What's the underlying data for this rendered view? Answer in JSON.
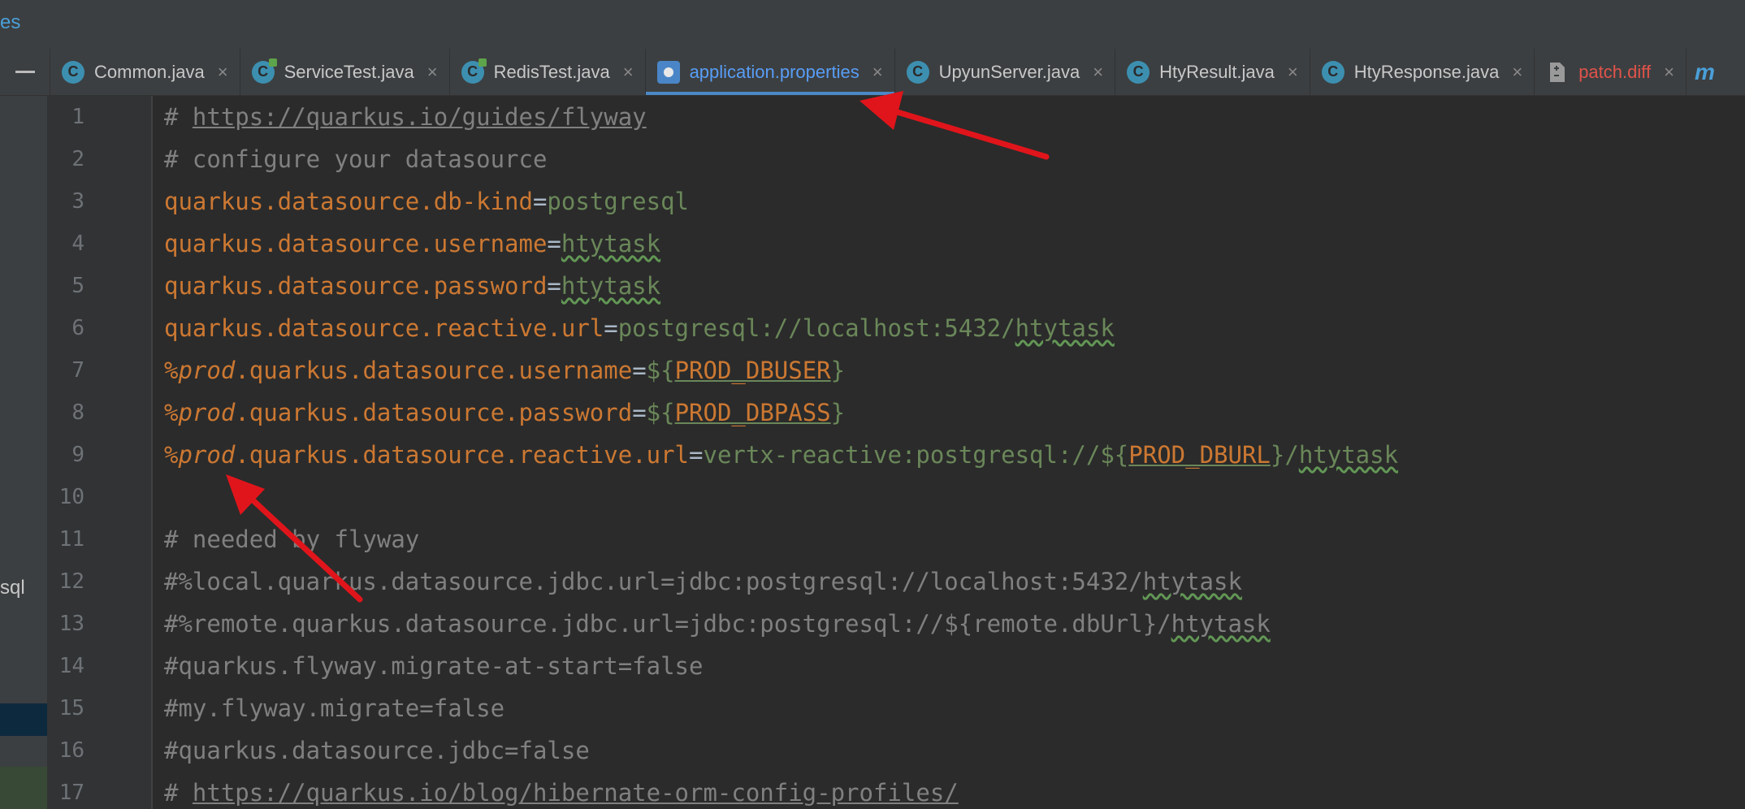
{
  "topstrip": {
    "crumb": "es"
  },
  "tabs": [
    {
      "label": "Common.java",
      "icon": "class-icon",
      "icon_glyph": "C",
      "kind": "class",
      "active": false
    },
    {
      "label": "ServiceTest.java",
      "icon": "test-class-icon",
      "icon_glyph": "C",
      "kind": "test",
      "active": false
    },
    {
      "label": "RedisTest.java",
      "icon": "test-class-icon",
      "icon_glyph": "C",
      "kind": "test",
      "active": false
    },
    {
      "label": "application.properties",
      "icon": "properties-icon",
      "icon_glyph": "",
      "kind": "props",
      "active": true
    },
    {
      "label": "UpyunServer.java",
      "icon": "class-icon",
      "icon_glyph": "C",
      "kind": "class",
      "active": false
    },
    {
      "label": "HtyResult.java",
      "icon": "class-icon",
      "icon_glyph": "C",
      "kind": "class",
      "active": false
    },
    {
      "label": "HtyResponse.java",
      "icon": "class-icon",
      "icon_glyph": "C",
      "kind": "class",
      "active": false
    },
    {
      "label": "patch.diff",
      "icon": "diff-file-icon",
      "icon_glyph": "",
      "kind": "diff",
      "active": false
    }
  ],
  "tab_close_glyph": "×",
  "tab_more_glyph": "m",
  "leftstrip": {
    "sql_label": "sql"
  },
  "line_numbers": [
    "1",
    "2",
    "3",
    "4",
    "5",
    "6",
    "7",
    "8",
    "9",
    "10",
    "11",
    "12",
    "13",
    "14",
    "15",
    "16",
    "17"
  ],
  "code": [
    [
      {
        "t": "# ",
        "c": "comment"
      },
      {
        "t": "https://quarkus.io/guides/flyway",
        "c": "comment link"
      }
    ],
    [
      {
        "t": "# configure your datasource",
        "c": "comment"
      }
    ],
    [
      {
        "t": "quarkus.datasource.db-kind",
        "c": "key"
      },
      {
        "t": "=",
        "c": "eq"
      },
      {
        "t": "postgresql",
        "c": "val"
      }
    ],
    [
      {
        "t": "quarkus.datasource.username",
        "c": "key"
      },
      {
        "t": "=",
        "c": "eq"
      },
      {
        "t": "htytask",
        "c": "val typo"
      }
    ],
    [
      {
        "t": "quarkus.datasource.password",
        "c": "key"
      },
      {
        "t": "=",
        "c": "eq"
      },
      {
        "t": "htytask",
        "c": "val typo"
      }
    ],
    [
      {
        "t": "quarkus.datasource.reactive.url",
        "c": "key"
      },
      {
        "t": "=",
        "c": "eq"
      },
      {
        "t": "postgresql://localhost:5432/",
        "c": "val"
      },
      {
        "t": "htytask",
        "c": "val typo"
      }
    ],
    [
      {
        "t": "%prod",
        "c": "prof"
      },
      {
        "t": ".quarkus.datasource.username",
        "c": "key"
      },
      {
        "t": "=",
        "c": "eq"
      },
      {
        "t": "${",
        "c": "val"
      },
      {
        "t": "PROD_DBUSER",
        "c": "envvar"
      },
      {
        "t": "}",
        "c": "val"
      }
    ],
    [
      {
        "t": "%prod",
        "c": "prof"
      },
      {
        "t": ".quarkus.datasource.password",
        "c": "key"
      },
      {
        "t": "=",
        "c": "eq"
      },
      {
        "t": "${",
        "c": "val"
      },
      {
        "t": "PROD_DBPASS",
        "c": "envvar"
      },
      {
        "t": "}",
        "c": "val"
      }
    ],
    [
      {
        "t": "%prod",
        "c": "prof"
      },
      {
        "t": ".quarkus.datasource.reactive.url",
        "c": "key"
      },
      {
        "t": "=",
        "c": "eq"
      },
      {
        "t": "vertx-reactive:postgresql://${",
        "c": "val"
      },
      {
        "t": "PROD_DBURL",
        "c": "envvar"
      },
      {
        "t": "}/",
        "c": "val"
      },
      {
        "t": "htytask",
        "c": "val typo"
      }
    ],
    [],
    [
      {
        "t": "# needed by flyway",
        "c": "comment"
      }
    ],
    [
      {
        "t": "#%local.quarkus.datasource.jdbc.url=jdbc:postgresql://localhost:5432/",
        "c": "comment"
      },
      {
        "t": "htytask",
        "c": "comment typo"
      }
    ],
    [
      {
        "t": "#%remote.quarkus.datasource.jdbc.url=jdbc:postgresql://${remote.dbUrl}/",
        "c": "comment"
      },
      {
        "t": "htytask",
        "c": "comment typo"
      }
    ],
    [
      {
        "t": "#quarkus.flyway.migrate-at-start=false",
        "c": "comment"
      }
    ],
    [
      {
        "t": "#my.flyway.migrate=false",
        "c": "comment"
      }
    ],
    [
      {
        "t": "#quarkus.datasource.jdbc=false",
        "c": "comment"
      }
    ],
    [
      {
        "t": "# ",
        "c": "comment"
      },
      {
        "t": "https://quarkus.io/blog/hibernate-orm-config-profiles/",
        "c": "comment link"
      }
    ]
  ],
  "colors": {
    "annotation_arrow": "#e0151b",
    "active_tab_text": "#589df6",
    "keyword": "#cc7832",
    "value": "#6a8759",
    "comment": "#808080"
  }
}
